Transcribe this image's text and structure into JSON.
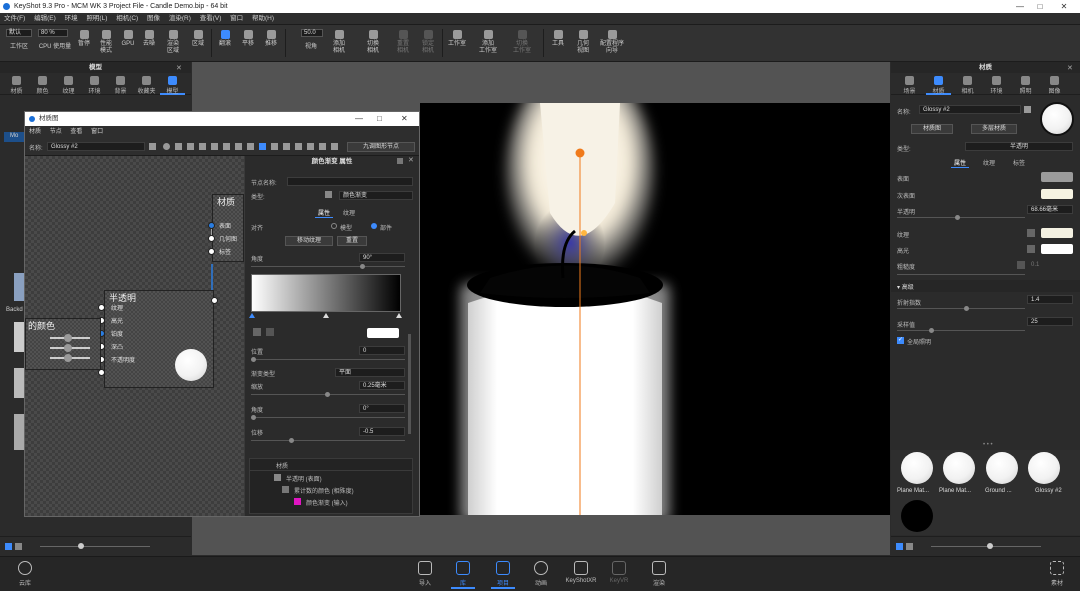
{
  "window": {
    "title": "KeyShot 9.3 Pro  -  MCM WK 3 Project File - Candle Demo.bip  -  64 bit",
    "controls": [
      "—",
      "□",
      "✕"
    ]
  },
  "menu": [
    "文件(F)",
    "编辑(E)",
    "环境",
    "照明(L)",
    "相机(C)",
    "图像",
    "渲染(R)",
    "查看(V)",
    "窗口",
    "帮助(H)"
  ],
  "toolbar": {
    "workspace_select": "默认",
    "workspace_label": "工作区",
    "cpu_value": "80 %",
    "cpu_label": "CPU 使用量",
    "pause": "暂停",
    "perf_mode": "性能\n模式",
    "gpu": "GPU",
    "denoise": "去噪",
    "region": "渲染\n区域",
    "pan_render": "区域",
    "tumble": "翻滚",
    "pan": "平移",
    "dolly": "推移",
    "fov_value": "50.0",
    "fov_label": "视角",
    "add_camera": "添加\n相机",
    "switch_camera": "切换\n相机",
    "reset_camera": "重置\n相机",
    "lock_camera": "锁定\n相机",
    "workspace2": "工作室",
    "add_studio": "添加\n工作室",
    "switch_studio": "切换\n工作室",
    "tools": "工具",
    "geometry": "几何\n视图",
    "config": "配置程序\n向导"
  },
  "left_panel": {
    "header": "模型",
    "tabs": [
      "材质",
      "颜色",
      "纹理",
      "环境",
      "背景",
      "收藏夹",
      "模型"
    ],
    "active_tab": 6,
    "tree_label": "Mo",
    "thumb_label": "Backd"
  },
  "material_window": {
    "title": "材质图",
    "menu": [
      "材质",
      "节点",
      "查看",
      "窗口"
    ],
    "name_label": "名称:",
    "name_value": "Glossy  #2",
    "clear_nodes": "九调图形节点",
    "nodes": {
      "material": {
        "title": "材质",
        "ports": [
          "表面",
          "几何图",
          "标签"
        ]
      },
      "translucent": {
        "title": "半透明",
        "ports": [
          "纹理",
          "高光",
          "铂度",
          "深凸",
          "不透明度"
        ]
      },
      "color": {
        "title": "的颜色"
      }
    },
    "props": {
      "header": "颜色渐变  属性",
      "node_name_label": "节点名称:",
      "type_label": "类型:",
      "type_value": "颜色渐变",
      "tabs": [
        "属性",
        "纹理"
      ],
      "align_label": "对齐",
      "align_options": [
        "模型",
        "部件"
      ],
      "align_selected": 1,
      "move_texture": "移动纹理",
      "reset": "重置",
      "angle_label": "角度",
      "angle_value": "90°",
      "position_label": "位置",
      "position_value": "0",
      "ramp_type_label": "渐变类型",
      "ramp_type_value": "平面",
      "scale_label": "缩放",
      "scale_value": "0.25毫米",
      "angle2_label": "角度",
      "angle2_value": "0°",
      "offset_label": "位移",
      "offset_value": "-0.5",
      "tree_header": "材质",
      "tree": [
        "半透明 (表面)",
        "累计数的颜色 (相殊度)",
        "颜色渐变 (输入)"
      ]
    }
  },
  "right_panel": {
    "header": "材质",
    "tabs": [
      "场景",
      "材质",
      "相机",
      "环境",
      "照明",
      "图像"
    ],
    "active_tab": 1,
    "name_label": "名称:",
    "name_value": "Glossy  #2",
    "material_graph_btn": "材质图",
    "multi_material_btn": "多层材质",
    "type_label": "类型:",
    "type_value": "半透明",
    "sub_tabs": [
      "属性",
      "纹理",
      "标签"
    ],
    "props": [
      {
        "label": "表面",
        "kind": "color",
        "color": "#9b9b9b"
      },
      {
        "label": "次表面",
        "kind": "color",
        "color": "#f6f3e2"
      },
      {
        "label": "半透明",
        "kind": "value",
        "value": "68.66毫米"
      },
      {
        "label": "纹理",
        "kind": "color",
        "color": "#f4f1e2"
      },
      {
        "label": "高光",
        "kind": "color",
        "color": "#ffffff"
      },
      {
        "label": "粗糙度",
        "kind": "value",
        "value": "0.1"
      }
    ],
    "advanced_header": "高级",
    "advanced": [
      {
        "label": "折射指数",
        "value": "1.4"
      },
      {
        "label": "采样值",
        "value": "25"
      }
    ],
    "global_illum": "全局照明",
    "library": [
      "Plane Mat...",
      "Plane Mat...",
      "Ground ...",
      "Glossy  #2",
      ""
    ]
  },
  "bottom_bar": {
    "cloud": "云库",
    "items": [
      "导入",
      "库",
      "项目",
      "动画",
      "KeyShotXR",
      "KeyVR",
      "渲染"
    ],
    "active": [
      1,
      2
    ],
    "right": "素材"
  }
}
